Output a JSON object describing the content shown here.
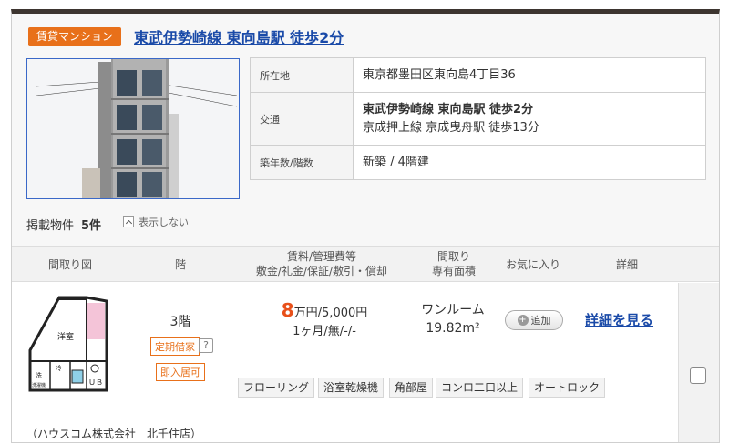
{
  "header": {
    "badge": "賃貸マンション",
    "title": "東武伊勢崎線 東向島駅 徒歩2分"
  },
  "property": {
    "rows": [
      {
        "key": "所在地",
        "lines": [
          "東京都墨田区東向島4丁目36"
        ]
      },
      {
        "key": "交通",
        "lines": [
          "東武伊勢崎線 東向島駅 徒歩2分",
          "京成押上線 京成曳舟駅 徒歩13分"
        ]
      },
      {
        "key": "築年数/階数",
        "lines": [
          "新築 / 4階建"
        ]
      }
    ],
    "listing_label": "掲載物件",
    "listing_count": "5件",
    "hide_label": "表示しない"
  },
  "columns": {
    "floorplan": "間取り図",
    "floor": "階",
    "rent_line1": "賃料/管理費等",
    "rent_line2": "敷金/礼金/保証/敷引・償却",
    "layout_line1": "間取り",
    "layout_line2": "専有面積",
    "favorite": "お気に入り",
    "detail": "詳細"
  },
  "unit": {
    "floor": "3階",
    "tag_fixed_term": "定期借家",
    "tag_question": "?",
    "tag_move_in": "即入居可",
    "rent_number": "8",
    "rent_rest": "万円/5,000円",
    "deposit": "1ヶ月/無/-/-",
    "layout": "ワンルーム",
    "area": "19.82m²",
    "add_label": "追加",
    "detail_link": "詳細を見る",
    "features": [
      "フローリング",
      "浴室乾燥機",
      "角部屋",
      "コンロ二口以上",
      "オートロック"
    ],
    "agent": "（ハウスコム株式会社　北千住店）",
    "floorplan_labels": {
      "main_room": "洋室",
      "wash": "洗",
      "washer": "洗濯機",
      "cold": "冷",
      "bath": "ＵＢ"
    }
  },
  "colors": {
    "accent_orange": "#e8701a",
    "link_blue": "#1a4aa8",
    "header_bar": "#3d3530"
  }
}
